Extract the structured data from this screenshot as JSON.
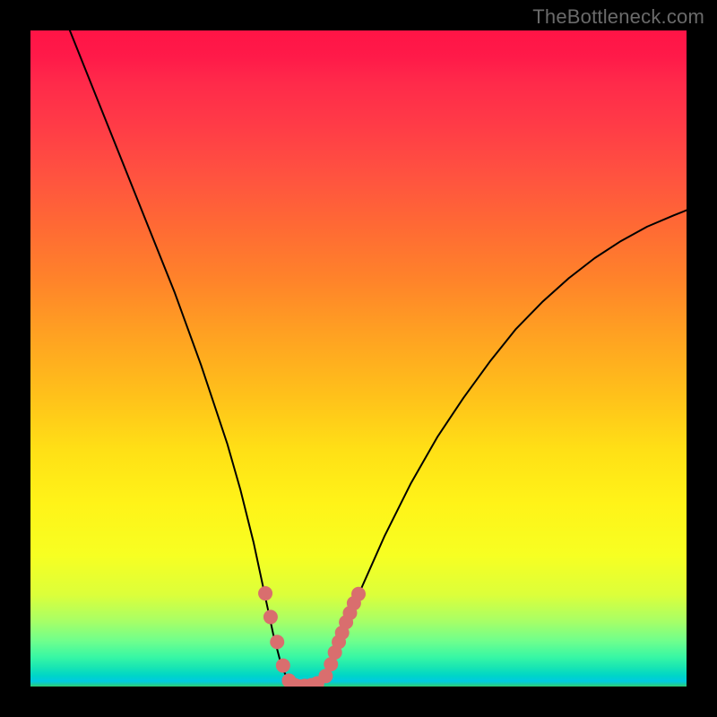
{
  "watermark": "TheBottleneck.com",
  "chart_data": {
    "type": "line",
    "title": "",
    "xlabel": "",
    "ylabel": "",
    "xlim": [
      0,
      100
    ],
    "ylim": [
      0,
      100
    ],
    "grid": false,
    "legend": false,
    "annotations": [],
    "series": [
      {
        "name": "bottleneck-curve",
        "color": "#000000",
        "x": [
          6,
          10,
          14,
          18,
          22,
          26,
          28,
          30,
          32,
          34,
          35.5,
          37,
          38.3,
          39.5,
          42,
          44,
          45.5,
          46.5,
          48,
          50,
          54,
          58,
          62,
          66,
          70,
          74,
          78,
          82,
          86,
          90,
          94,
          98,
          100
        ],
        "y": [
          100,
          90,
          80,
          70,
          60,
          49,
          43,
          37,
          30,
          22,
          15,
          8,
          3,
          0.5,
          0,
          0.5,
          2.5,
          5,
          9,
          14,
          23,
          31,
          38,
          44,
          49.5,
          54.5,
          58.6,
          62.2,
          65.3,
          67.9,
          70.1,
          71.8,
          72.6
        ]
      },
      {
        "name": "bottom-markers-left",
        "color": "#d96e6e",
        "type": "scatter",
        "x": [
          35.8,
          36.6,
          37.6,
          38.5,
          39.4,
          40.3,
          41.0,
          41.8,
          42.8,
          43.7
        ],
        "y": [
          14.2,
          10.6,
          6.8,
          3.2,
          0.9,
          0.2,
          0.0,
          0.1,
          0.2,
          0.5
        ]
      },
      {
        "name": "bottom-markers-right",
        "color": "#d96e6e",
        "type": "scatter",
        "x": [
          45.0,
          45.8,
          46.4,
          47.0,
          47.5,
          48.1,
          48.7,
          49.3,
          50.0
        ],
        "y": [
          1.6,
          3.4,
          5.2,
          6.8,
          8.2,
          9.8,
          11.2,
          12.7,
          14.1
        ]
      }
    ]
  }
}
